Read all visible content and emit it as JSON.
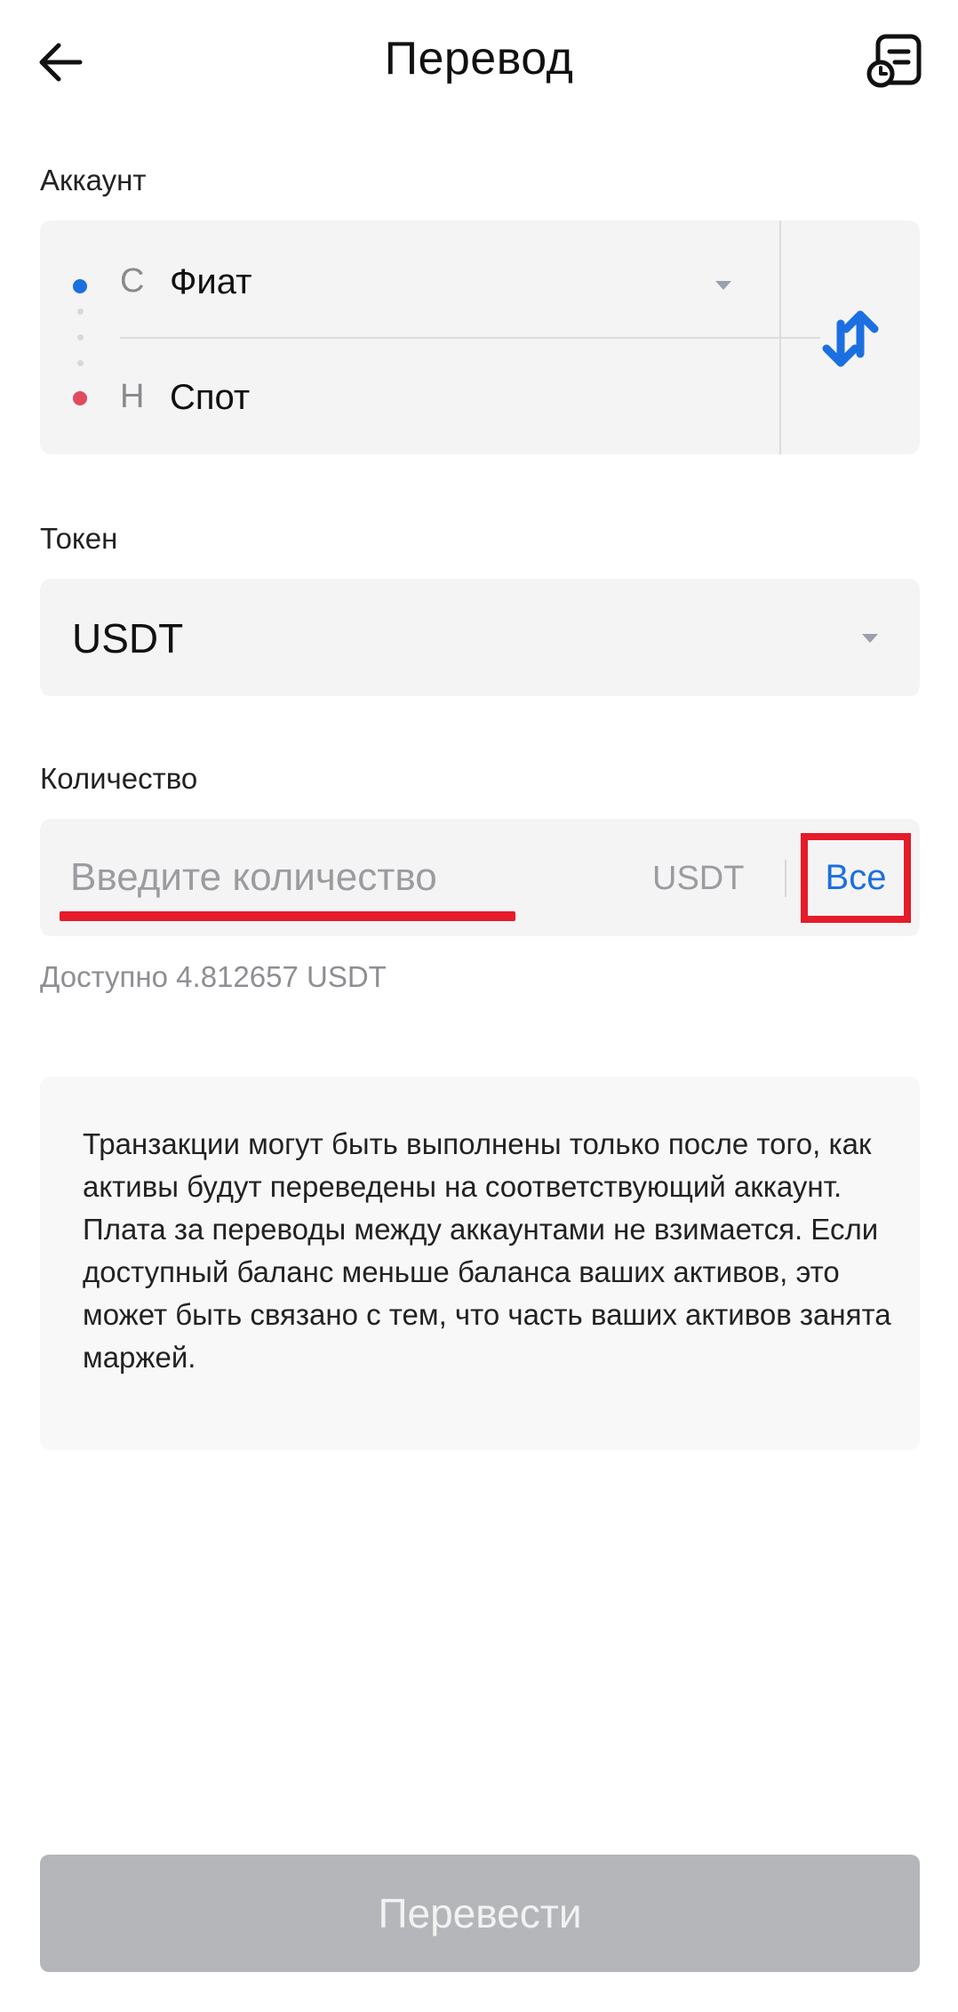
{
  "header": {
    "title": "Перевод",
    "back_icon": "arrow-left-icon",
    "history_icon": "transfer-history-icon"
  },
  "account": {
    "label": "Аккаунт",
    "from": {
      "prefix": "С",
      "name": "Фиат",
      "dot_color": "#1c6fe0"
    },
    "to": {
      "prefix": "Н",
      "name": "Спот",
      "dot_color": "#e04a5e"
    },
    "swap_icon": "swap-arrows-icon"
  },
  "token": {
    "label": "Токен",
    "value": "USDT"
  },
  "amount": {
    "label": "Количество",
    "placeholder": "Введите количество",
    "value": "",
    "unit": "USDT",
    "all_label": "Все"
  },
  "available": "Доступно 4.812657 USDT",
  "notice": "Транзакции могут быть выполнены только после того, как активы будут переведены на соответствующий аккаунт. Плата за переводы между аккаунтами не взимается. Если доступный баланс меньше баланса ваших активов, это может быть связано с тем, что часть ваших активов занята маржей.",
  "submit_label": "Перевести",
  "colors": {
    "accent": "#1c6fe0",
    "highlight": "#e51c2a",
    "disabled_button": "#b4b6b9",
    "field_bg": "#f4f4f5"
  }
}
